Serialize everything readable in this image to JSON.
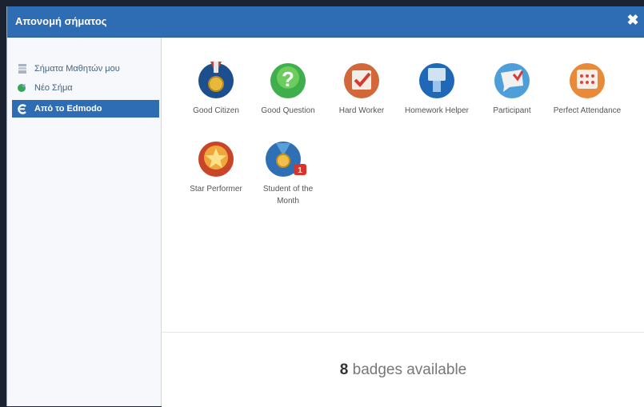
{
  "dialog": {
    "title": "Απονομή σήματος"
  },
  "sidebar": {
    "items": [
      {
        "label": "Σήματα Μαθητών μου",
        "icon": "badge-stack-icon"
      },
      {
        "label": "Νέο Σήμα",
        "icon": "new-badge-icon"
      },
      {
        "label": "Από το Edmodo",
        "icon": "edmodo-icon",
        "active": true
      }
    ]
  },
  "badges": [
    {
      "label": "Good Citizen",
      "icon": "medal-icon"
    },
    {
      "label": "Good Question",
      "icon": "question-icon"
    },
    {
      "label": "Hard Worker",
      "icon": "checkmark-icon"
    },
    {
      "label": "Homework Helper",
      "icon": "helper-icon"
    },
    {
      "label": "Participant",
      "icon": "chat-bubble-icon"
    },
    {
      "label": "Perfect Attendance",
      "icon": "calendar-icon"
    },
    {
      "label": "Star Performer",
      "icon": "star-icon"
    },
    {
      "label": "Student of the Month",
      "icon": "ribbon-medal-icon",
      "notification": "1"
    }
  ],
  "footer": {
    "count": "8",
    "count_suffix": " badges available"
  },
  "colors": {
    "header": "#2e6db4",
    "active_item": "#2e6db4"
  }
}
